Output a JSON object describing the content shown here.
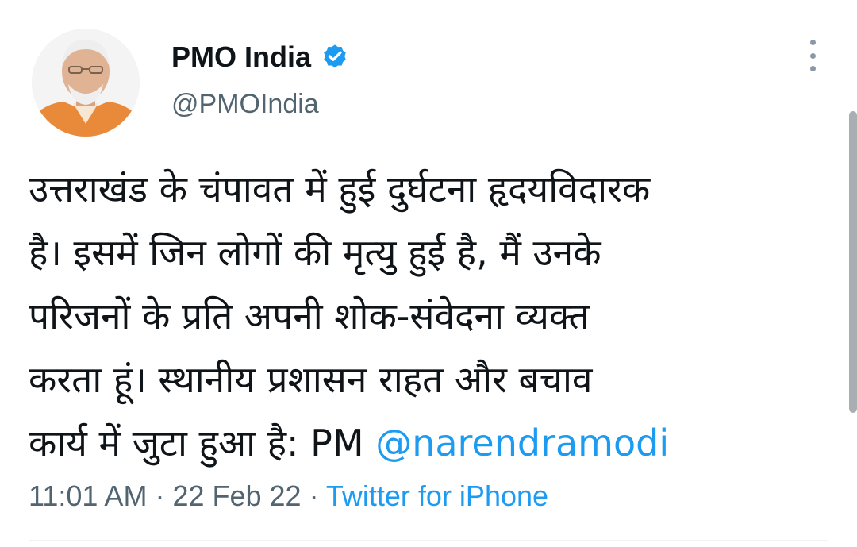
{
  "author": {
    "display_name": "PMO India",
    "handle": "@PMOIndia",
    "verified": true,
    "avatar_icon": "profile-photo"
  },
  "tweet": {
    "lines": [
      "उत्तराखंड के चंपावत में हुई दुर्घटना हृदयविदारक",
      "है। इसमें जिन लोगों की मृत्यु हुई है, मैं उनके",
      "परिजनों के प्रति अपनी शोक-संवेदना व्यक्त",
      "करता हूं। स्थानीय प्रशासन राहत और बचाव"
    ],
    "last_line_text": "कार्य में जुटा हुआ है: PM ",
    "mention": "@narendramodi"
  },
  "meta": {
    "time": "11:01 AM",
    "separator1": " · ",
    "date": "22 Feb 22",
    "separator2": " · ",
    "source": "Twitter for iPhone"
  },
  "colors": {
    "accent": "#1d9bf0",
    "secondary_text": "#536471",
    "primary_text": "#0f1419"
  },
  "icons": {
    "more": "more-options-icon",
    "verified": "verified-badge-icon"
  }
}
